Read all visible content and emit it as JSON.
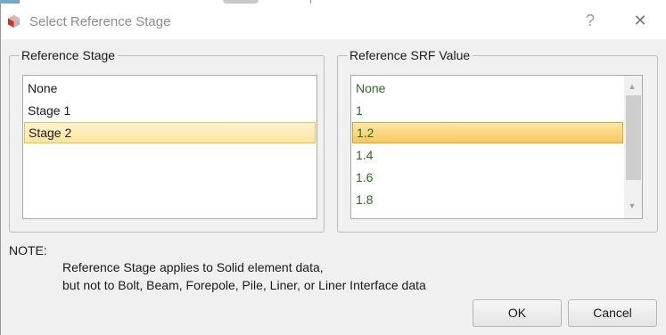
{
  "window": {
    "title": "Select Reference Stage",
    "help_glyph": "?",
    "close_glyph": "✕"
  },
  "reference_stage": {
    "label": "Reference Stage",
    "items": [
      "None",
      "Stage 1",
      "Stage 2"
    ],
    "selected_index": 2
  },
  "reference_srf": {
    "label": "Reference SRF Value",
    "items": [
      "None",
      "1",
      "1.2",
      "1.4",
      "1.6",
      "1.8"
    ],
    "selected_index": 2
  },
  "note": {
    "label": "NOTE:",
    "line1": "Reference Stage applies to Solid element data,",
    "line2": "but not to Bolt, Beam, Forepole, Pile, Liner, or Liner Interface data"
  },
  "buttons": {
    "ok": "OK",
    "cancel": "Cancel"
  },
  "colors": {
    "srf_text": "#2e6b1e",
    "selection": "#ffe49b"
  }
}
